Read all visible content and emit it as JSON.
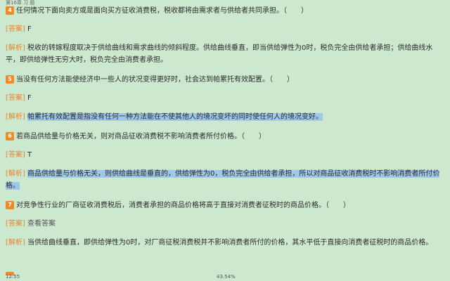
{
  "header": {
    "chapter": "第16章  习  题"
  },
  "items": [
    {
      "number": "4",
      "question": "任何情况下面向卖方或是面向买方征收消费税，税收都将由需求者与供给者共同承担。（　　）",
      "answer_label": "[答案]",
      "answer": "F",
      "analysis_label": "[解析]",
      "analysis": "税收的转嫁程度取决于供给曲线和需求曲线的倾斜程度。供给曲线垂直，即当供给弹性为0时，税负完全由供给者承担；供给曲线水平，即供给弹性无穷大时，税负完全由消费者承担。"
    },
    {
      "number": "5",
      "question": "当没有任何方法能使经济中一些人的状况变得更好时，社会达到帕累托有效配置。（　　）",
      "answer_label": "[答案]",
      "answer": "F",
      "analysis_label": "[解析]",
      "analysis": "帕累托有效配置是指没有任何一种方法能在不使其他人的境况变坏的同时使任何人的境况变好。"
    },
    {
      "number": "6",
      "question": "若商品供给量与价格无关，则对商品征收消费税不影响消费者所付价格。（　　）",
      "answer_label": "[答案]",
      "answer": "T",
      "analysis_label": "[解析]",
      "analysis": "商品供给量与价格无关，则供给曲线是垂直的，供给弹性为0，税负完全由供给者承担，所以对商品征收消费税时不影响消费者所付价格。"
    },
    {
      "number": "7",
      "question": "对竞争性行业的厂商征收消费税后，消费者承担的商品价格将高于直接对消费者征税时的商品价格。（　　）",
      "answer_label": "[答案]",
      "answer": "查看答案",
      "analysis_label": "[解析]",
      "analysis": "当供给曲线垂直，即供给弹性为0时，对厂商征税消费税并不影响消费者所付的价格，其水平低于直接向消费者征税时的商品价格。"
    }
  ],
  "status": {
    "time": "12:55",
    "progress": "43.54%"
  }
}
